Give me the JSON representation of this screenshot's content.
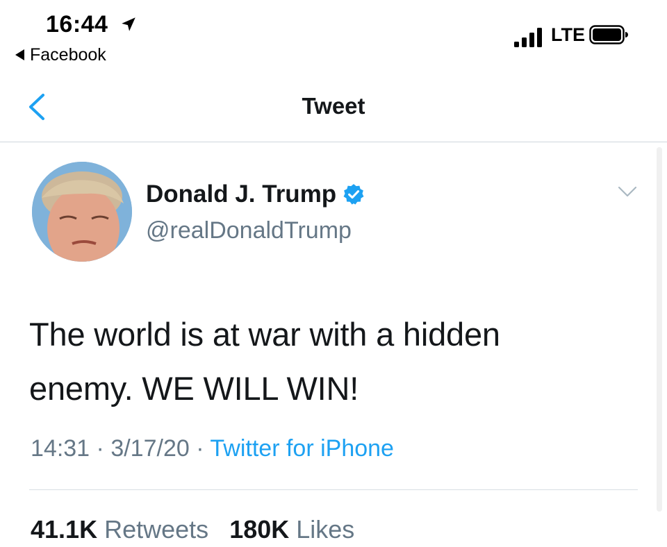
{
  "status_bar": {
    "time": "16:44",
    "back_app": "Facebook",
    "network": "LTE"
  },
  "nav": {
    "title": "Tweet"
  },
  "tweet": {
    "author_name": "Donald J. Trump",
    "author_handle": "@realDonaldTrump",
    "text_line1": "The world is at war with a hidden",
    "text_line2": "enemy. WE WILL WIN!",
    "time": "14:31",
    "separator": "·",
    "date": "3/17/20",
    "source": "Twitter for iPhone",
    "retweets_count": "41.1K",
    "retweets_label": "Retweets",
    "likes_count": "180K",
    "likes_label": "Likes"
  },
  "colors": {
    "accent": "#1da1f2",
    "text": "#14171a",
    "secondary": "#657786"
  },
  "icons": [
    "location-arrow-icon",
    "signal-icon",
    "battery-icon",
    "back-chevron-icon",
    "verified-badge-icon",
    "caret-down-icon"
  ]
}
